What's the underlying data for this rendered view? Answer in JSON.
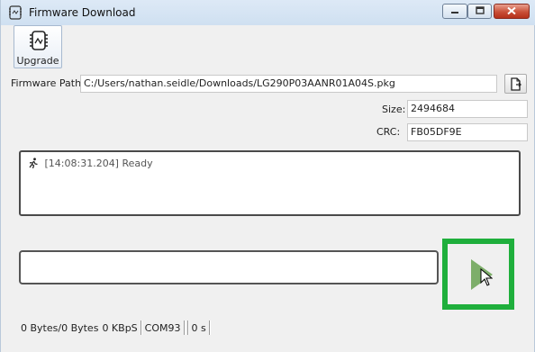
{
  "window": {
    "title": "Firmware Download"
  },
  "toolbar": {
    "upgrade_label": "Upgrade"
  },
  "firmware": {
    "path_label": "Firmware Path:",
    "path_value": "C:/Users/nathan.seidle/Downloads/LG290P03AANR01A04S.pkg",
    "size_label": "Size:",
    "size_value": "2494684",
    "crc_label": "CRC:",
    "crc_value": "FB05DF9E"
  },
  "log": {
    "entries": [
      {
        "timestamp": "[14:08:31.204]",
        "message": "Ready"
      }
    ]
  },
  "progress": {
    "fraction": 0
  },
  "status": {
    "bytes": "0 Bytes/0 Bytes",
    "rate": "0 KBpS",
    "port": "COM93",
    "elapsed": "0 s"
  },
  "colors": {
    "start_button_frame": "#1faf3c",
    "start_button_play": "#7dae6a"
  }
}
